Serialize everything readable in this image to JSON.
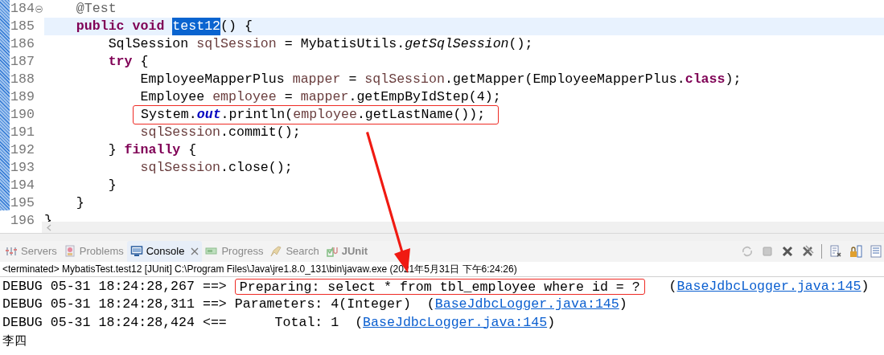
{
  "editor": {
    "lines": [
      {
        "number": "184",
        "foldable": true,
        "current": false,
        "highlighted": false,
        "tokens": [
          {
            "kind": "annotation",
            "text": "    @Test"
          }
        ]
      },
      {
        "number": "185",
        "foldable": false,
        "current": true,
        "highlighted": false,
        "tokens": [
          {
            "kind": "keyword",
            "text": "    public void "
          },
          {
            "kind": "selection",
            "text": "test12"
          },
          {
            "kind": "plain",
            "text": "() {"
          }
        ]
      },
      {
        "number": "186",
        "foldable": false,
        "current": false,
        "highlighted": false,
        "tokens": [
          {
            "kind": "plain",
            "text": "        SqlSession "
          },
          {
            "kind": "local",
            "text": "sqlSession"
          },
          {
            "kind": "plain",
            "text": " = MybatisUtils."
          },
          {
            "kind": "static_method",
            "text": "getSqlSession"
          },
          {
            "kind": "plain",
            "text": "();"
          }
        ]
      },
      {
        "number": "187",
        "foldable": false,
        "current": false,
        "highlighted": false,
        "tokens": [
          {
            "kind": "keyword",
            "text": "        try"
          },
          {
            "kind": "plain",
            "text": " {"
          }
        ]
      },
      {
        "number": "188",
        "foldable": false,
        "current": false,
        "highlighted": false,
        "tokens": [
          {
            "kind": "plain",
            "text": "            EmployeeMapperPlus "
          },
          {
            "kind": "local",
            "text": "mapper"
          },
          {
            "kind": "plain",
            "text": " = "
          },
          {
            "kind": "local",
            "text": "sqlSession"
          },
          {
            "kind": "plain",
            "text": ".getMapper(EmployeeMapperPlus."
          },
          {
            "kind": "keyword",
            "text": "class"
          },
          {
            "kind": "plain",
            "text": ");"
          }
        ]
      },
      {
        "number": "189",
        "foldable": false,
        "current": false,
        "highlighted": false,
        "tokens": [
          {
            "kind": "plain",
            "text": "            Employee "
          },
          {
            "kind": "local",
            "text": "employee"
          },
          {
            "kind": "plain",
            "text": " = "
          },
          {
            "kind": "local",
            "text": "mapper"
          },
          {
            "kind": "plain",
            "text": ".getEmpByIdStep(4);"
          }
        ]
      },
      {
        "number": "190",
        "foldable": false,
        "current": false,
        "highlighted": true,
        "tokens": [
          {
            "kind": "plain",
            "text": "System."
          },
          {
            "kind": "static_field",
            "text": "out"
          },
          {
            "kind": "plain",
            "text": ".println("
          },
          {
            "kind": "local",
            "text": "employee"
          },
          {
            "kind": "plain",
            "text": ".getLastName());"
          }
        ]
      },
      {
        "number": "191",
        "foldable": false,
        "current": false,
        "highlighted": false,
        "tokens": [
          {
            "kind": "local",
            "text": "            sqlSession"
          },
          {
            "kind": "plain",
            "text": ".commit();"
          }
        ]
      },
      {
        "number": "192",
        "foldable": false,
        "current": false,
        "highlighted": false,
        "tokens": [
          {
            "kind": "plain",
            "text": "        } "
          },
          {
            "kind": "keyword",
            "text": "finally"
          },
          {
            "kind": "plain",
            "text": " {"
          }
        ]
      },
      {
        "number": "193",
        "foldable": false,
        "current": false,
        "highlighted": false,
        "tokens": [
          {
            "kind": "local",
            "text": "            sqlSession"
          },
          {
            "kind": "plain",
            "text": ".close();"
          }
        ]
      },
      {
        "number": "194",
        "foldable": false,
        "current": false,
        "highlighted": false,
        "tokens": [
          {
            "kind": "plain",
            "text": "        }"
          }
        ]
      },
      {
        "number": "195",
        "foldable": false,
        "current": false,
        "highlighted": false,
        "tokens": [
          {
            "kind": "plain",
            "text": "    }"
          }
        ]
      },
      {
        "number": "196",
        "foldable": false,
        "current": false,
        "highlighted": false,
        "tokens": [
          {
            "kind": "plain",
            "text": "}"
          }
        ]
      }
    ]
  },
  "panel": {
    "tabs": [
      {
        "label": "Servers",
        "selected": false,
        "closable": false,
        "bold": false
      },
      {
        "label": "Problems",
        "selected": false,
        "closable": false,
        "bold": false
      },
      {
        "label": "Console",
        "selected": true,
        "closable": true,
        "bold": false
      },
      {
        "label": "Progress",
        "selected": false,
        "closable": false,
        "bold": false
      },
      {
        "label": "Search",
        "selected": false,
        "closable": false,
        "bold": false
      },
      {
        "label": "JUnit",
        "selected": false,
        "closable": false,
        "bold": true
      }
    ],
    "header": "<terminated> MybatisTest.test12 [JUnit] C:\\Program Files\\Java\\jre1.8.0_131\\bin\\javaw.exe (2021年5月31日 下午6:24:26)",
    "lines": [
      {
        "segments": [
          {
            "kind": "text",
            "text": "DEBUG 05-31 18:24:28,267 ==> "
          },
          {
            "kind": "boxed",
            "text": "Preparing: select * from tbl_employee where id = ?"
          },
          {
            "kind": "text",
            "text": "   ("
          },
          {
            "kind": "link",
            "text": "BaseJdbcLogger.java:145"
          },
          {
            "kind": "text",
            "text": ")"
          }
        ]
      },
      {
        "segments": [
          {
            "kind": "text",
            "text": "DEBUG 05-31 18:24:28,311 ==> Parameters: 4(Integer)  ("
          },
          {
            "kind": "link",
            "text": "BaseJdbcLogger.java:145"
          },
          {
            "kind": "text",
            "text": ")"
          }
        ]
      },
      {
        "segments": [
          {
            "kind": "text",
            "text": "DEBUG 05-31 18:24:28,424 <==      Total: 1  ("
          },
          {
            "kind": "link",
            "text": "BaseJdbcLogger.java:145"
          },
          {
            "kind": "text",
            "text": ")"
          }
        ]
      },
      {
        "segments": [
          {
            "kind": "output",
            "text": "李四"
          }
        ]
      }
    ]
  }
}
